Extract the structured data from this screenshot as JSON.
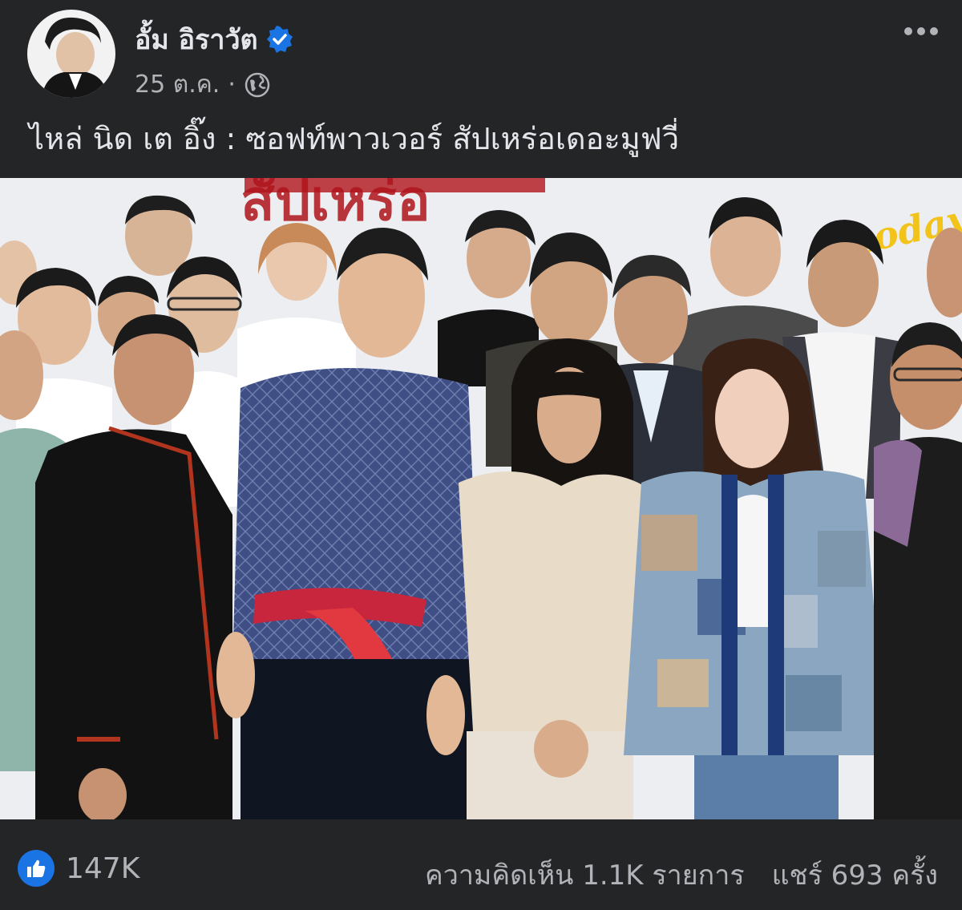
{
  "post": {
    "author": "อั้ม อิราวัต",
    "date": "25 ต.ค.",
    "separator": "·",
    "caption": "ไหล่ นิด เต อิ๊ง : ซอฟท์พาวเวอร์ สัปเหร่อเดอะมูฟวี่",
    "verified": true,
    "privacy_icon": "globe-icon"
  },
  "photo": {
    "watermark": "today",
    "banner_text": "สัปเหร่อ"
  },
  "footer": {
    "likes": "147K",
    "comments": "ความคิดเห็น 1.1K รายการ",
    "shares": "แชร์ 693 ครั้ง"
  },
  "colors": {
    "background": "#242526",
    "accent": "#1b74e4",
    "text_primary": "#e4e6eb",
    "text_secondary": "#b0b3b8"
  }
}
